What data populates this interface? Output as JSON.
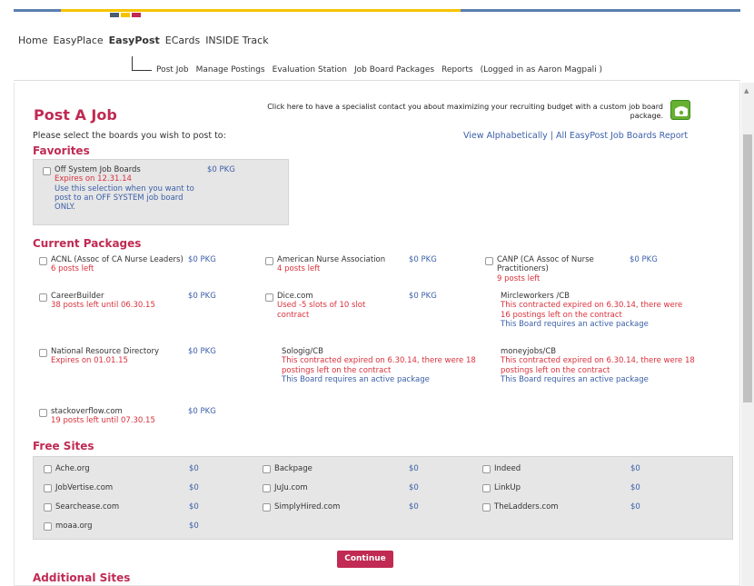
{
  "colors": {
    "accent": "#c02a53",
    "link": "#3b5fa8",
    "alert": "#d8313b",
    "logo_squares": [
      "#4b5b70",
      "#f5c400",
      "#c02a53"
    ]
  },
  "main_nav": [
    "Home",
    "EasyPlace",
    "EasyPost",
    "ECards",
    "INSIDE Track"
  ],
  "main_nav_active": "EasyPost",
  "sub_nav": [
    "Post Job",
    "Manage Postings",
    "Evaluation Station",
    "Job Board Packages",
    "Reports",
    "(Logged in as Aaron Magpali )"
  ],
  "page": {
    "title": "Post A Job",
    "callout": "Click here to have a specialist contact you about maximizing your recruiting budget with a custom job board package.",
    "callout_icon": "phone-icon",
    "instruction": "Please select the boards you wish to post to:",
    "link_alpha": "View Alphabetically",
    "link_sep": " | ",
    "link_report": "All EasyPost Job Boards Report"
  },
  "favorites": {
    "heading": "Favorites",
    "item": {
      "name": "Off System Job Boards",
      "price": "$0 PKG",
      "expires": "Expires on 12.31.14",
      "note": "Use this selection when you want to post to an OFF SYSTEM job board ONLY."
    }
  },
  "current": {
    "heading": "Current Packages",
    "acnl": {
      "name": "ACNL (Assoc of CA Nurse Leaders)",
      "price": "$0 PKG",
      "status": "6 posts left"
    },
    "ana": {
      "name": "American Nurse Association",
      "price": "$0 PKG",
      "status": "4 posts left"
    },
    "canp": {
      "name": "CANP (CA Assoc of Nurse Practitioners)",
      "price": "$0 PKG",
      "status": "9 posts left"
    },
    "cb": {
      "name": "CareerBuilder",
      "price": "$0 PKG",
      "status": "38 posts left until 06.30.15"
    },
    "dice": {
      "name": "Dice.com",
      "price": "$0 PKG",
      "status": "Used -5 slots of 10 slot contract"
    },
    "mirc": {
      "name": "Mircleworkers /CB",
      "status": "This contracted expired on 6.30.14, there were 16 postings left on the contract",
      "note": "This Board requires an active package"
    },
    "nrd": {
      "name": "National Resource Directory",
      "price": "$0 PKG",
      "status": "Expires on 01.01.15"
    },
    "sologig": {
      "name": "Sologig/CB",
      "status": "This contracted expired on 6.30.14, there were 18 postings left on the contract",
      "note": "This Board requires an active package"
    },
    "money": {
      "name": "moneyjobs/CB",
      "status": "This contracted expired on 6.30.14, there were 18 postings left on the contract",
      "note": "This Board requires an active package"
    },
    "so": {
      "name": "stackoverflow.com",
      "price": "$0 PKG",
      "status": "19 posts left until 07.30.15"
    }
  },
  "free": {
    "heading": "Free Sites",
    "items": [
      {
        "name": "Ache.org",
        "price": "$0"
      },
      {
        "name": "Backpage",
        "price": "$0"
      },
      {
        "name": "Indeed",
        "price": "$0"
      },
      {
        "name": "JobVertise.com",
        "price": "$0"
      },
      {
        "name": "JuJu.com",
        "price": "$0"
      },
      {
        "name": "LinkUp",
        "price": "$0"
      },
      {
        "name": "Searchease.com",
        "price": "$0"
      },
      {
        "name": "SimplyHired.com",
        "price": "$0"
      },
      {
        "name": "TheLadders.com",
        "price": "$0"
      },
      {
        "name": "moaa.org",
        "price": "$0"
      }
    ]
  },
  "continue_label": "Continue",
  "additional_heading": "Additional Sites"
}
